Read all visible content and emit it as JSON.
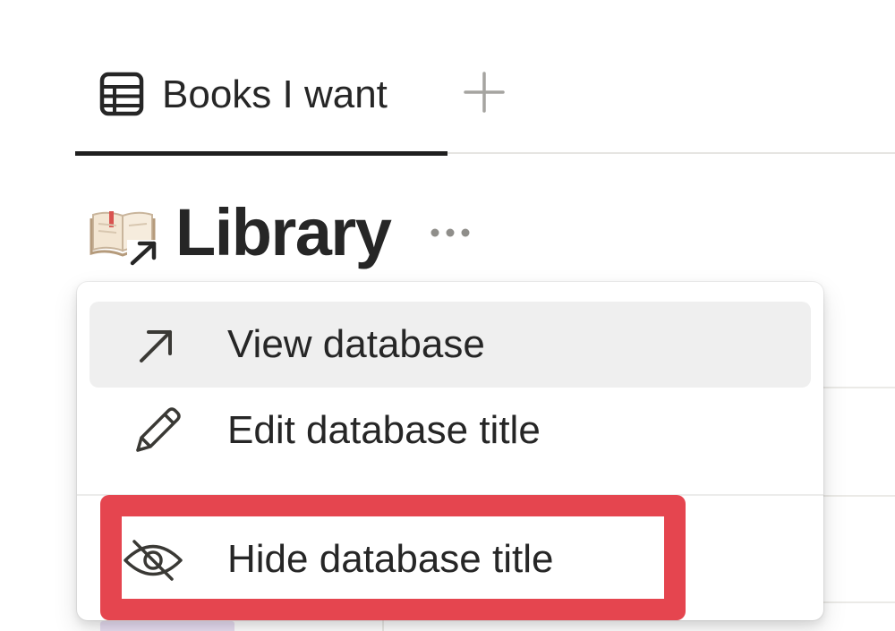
{
  "tabs": [
    {
      "label": "Books I want",
      "icon": "table-icon",
      "active": true
    }
  ],
  "add_view_icon": "plus-icon",
  "database": {
    "title": "Library",
    "icon": "open-book-linked-icon",
    "more_icon": "ellipsis-icon"
  },
  "menu": {
    "items": [
      {
        "label": "View database",
        "icon": "arrow-up-right-icon",
        "hovered": true
      },
      {
        "label": "Edit database title",
        "icon": "pencil-icon",
        "hovered": false
      },
      {
        "label": "Hide database title",
        "icon": "eye-slash-icon",
        "hovered": false,
        "highlighted": true
      }
    ]
  },
  "colors": {
    "text": "#262626",
    "highlight": "#e5454f",
    "hover_bg": "#efefef",
    "tab_underline": "#1f1f1f"
  }
}
